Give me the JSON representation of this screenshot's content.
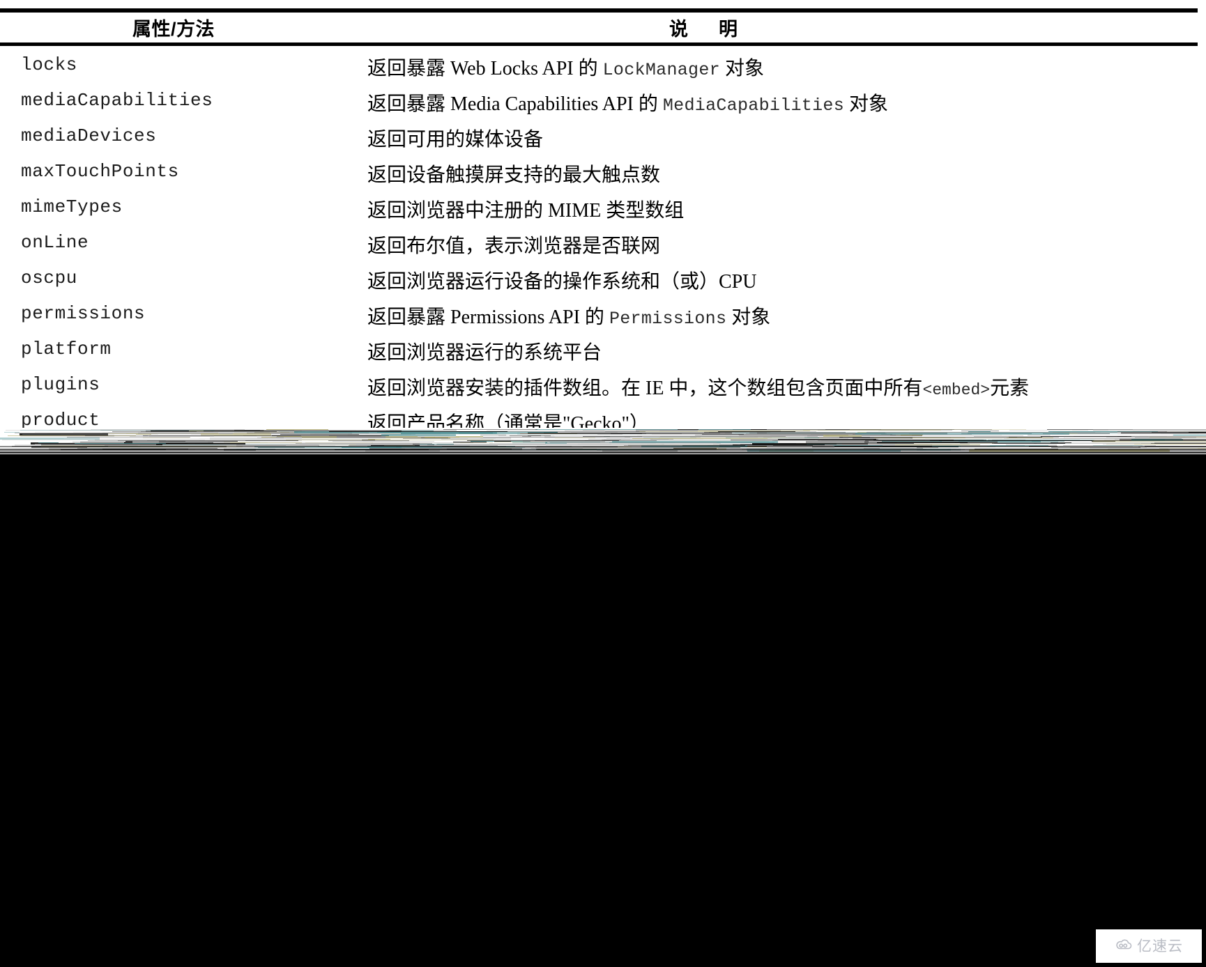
{
  "page": {
    "background_color": "#000000",
    "document_background_color": "#ffffff"
  },
  "table": {
    "headers": {
      "property_method": "属性/方法",
      "description_part1": "说",
      "description_part2": "明"
    },
    "rows": [
      {
        "property": "locks",
        "desc_pre": "返回暴露 Web Locks API 的 ",
        "desc_code": "LockManager",
        "desc_post": " 对象"
      },
      {
        "property": "mediaCapabilities",
        "desc_pre": "返回暴露 Media Capabilities API 的 ",
        "desc_code": "MediaCapabilities",
        "desc_post": " 对象"
      },
      {
        "property": "mediaDevices",
        "desc_pre": "返回可用的媒体设备",
        "desc_code": "",
        "desc_post": ""
      },
      {
        "property": "maxTouchPoints",
        "desc_pre": "返回设备触摸屏支持的最大触点数",
        "desc_code": "",
        "desc_post": ""
      },
      {
        "property": "mimeTypes",
        "desc_pre": "返回浏览器中注册的 MIME 类型数组",
        "desc_code": "",
        "desc_post": ""
      },
      {
        "property": "onLine",
        "desc_pre": "返回布尔值，表示浏览器是否联网",
        "desc_code": "",
        "desc_post": ""
      },
      {
        "property": "oscpu",
        "desc_pre": "返回浏览器运行设备的操作系统和（或）CPU",
        "desc_code": "",
        "desc_post": ""
      },
      {
        "property": "permissions",
        "desc_pre": "返回暴露 Permissions API 的 ",
        "desc_code": "Permissions",
        "desc_post": " 对象"
      },
      {
        "property": "platform",
        "desc_pre": "返回浏览器运行的系统平台",
        "desc_code": "",
        "desc_post": ""
      },
      {
        "property": "plugins",
        "desc_pre": "返回浏览器安装的插件数组。在 IE 中，这个数组包含页面中所有",
        "desc_code": "<embed>",
        "desc_post": "元素"
      },
      {
        "property": "product",
        "desc_pre": "返回产品名称（通常是\"Gecko\"）",
        "desc_code": "",
        "desc_post": ""
      }
    ]
  },
  "watermark": {
    "text": "亿速云",
    "icon": "cloud-icon",
    "color": "#b9bcc4"
  }
}
